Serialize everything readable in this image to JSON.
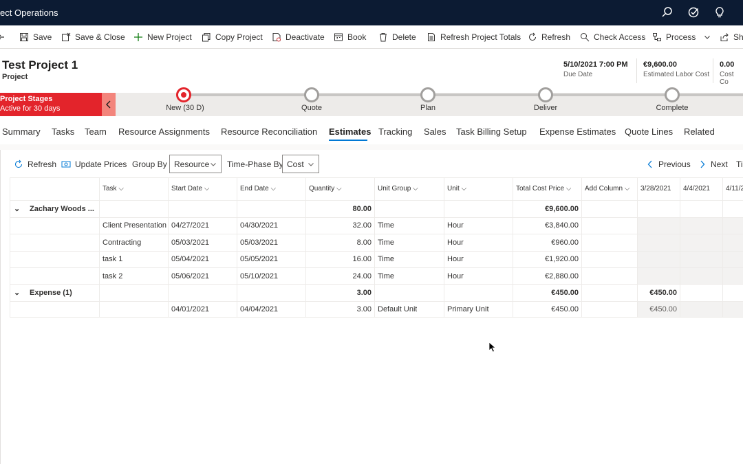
{
  "app": {
    "title": "ect Operations"
  },
  "commands": [
    {
      "label": "Save",
      "icon": "save-icon"
    },
    {
      "label": "Save & Close",
      "icon": "save-close-icon"
    },
    {
      "label": "New Project",
      "icon": "plus-icon"
    },
    {
      "label": "Copy Project",
      "icon": "copy-icon"
    },
    {
      "label": "Deactivate",
      "icon": "deactivate-icon"
    },
    {
      "label": "Book",
      "icon": "book-icon"
    },
    {
      "label": "Delete",
      "icon": "trash-icon"
    },
    {
      "label": "Refresh Project Totals",
      "icon": "document-icon"
    },
    {
      "label": "Refresh",
      "icon": "refresh-icon"
    },
    {
      "label": "Check Access",
      "icon": "search-icon"
    },
    {
      "label": "Process",
      "icon": "process-icon"
    },
    {
      "label": "Sh",
      "icon": "share-icon"
    }
  ],
  "header": {
    "title": "Test Project 1",
    "entity": "Project",
    "fields": [
      {
        "value": "5/10/2021 7:00 PM",
        "label": "Due Date"
      },
      {
        "value": "€9,600.00",
        "label": "Estimated Labor Cost"
      },
      {
        "value": "0.00",
        "label": "Cost Co"
      }
    ]
  },
  "stages": {
    "badge_title": "Project Stages",
    "badge_sub": "Active for 30 days",
    "items": [
      "New  (30 D)",
      "Quote",
      "Plan",
      "Deliver",
      "Complete"
    ]
  },
  "tabs": [
    "Summary",
    "Tasks",
    "Team",
    "Resource Assignments",
    "Resource Reconciliation",
    "Estimates",
    "Tracking",
    "Sales",
    "Task Billing Setup",
    "Expense Estimates",
    "Quote Lines",
    "Related"
  ],
  "grid_toolbar": {
    "refresh": "Refresh",
    "update_prices": "Update Prices",
    "group_by_label": "Group By",
    "group_by_value": "Resource",
    "time_phase_label": "Time-Phase By",
    "time_phase_value": "Cost",
    "previous": "Previous",
    "next": "Next",
    "ti": "Ti"
  },
  "grid": {
    "columns": [
      "Task",
      "Start Date",
      "End Date",
      "Quantity",
      "Unit Group",
      "Unit",
      "Total Cost Price",
      "Add Column",
      "3/28/2021",
      "4/4/2021",
      "4/11/2"
    ],
    "groups": [
      {
        "name": "Zachary Woods ...",
        "quantity": "80.00",
        "total": "€9,600.00",
        "week1": "",
        "rows": [
          {
            "task": "Client Presentation",
            "start": "04/27/2021",
            "end": "04/30/2021",
            "qty": "32.00",
            "ugroup": "Time",
            "unit": "Hour",
            "total": "€3,840.00",
            "week1": ""
          },
          {
            "task": "Contracting",
            "start": "05/03/2021",
            "end": "05/03/2021",
            "qty": "8.00",
            "ugroup": "Time",
            "unit": "Hour",
            "total": "€960.00",
            "week1": ""
          },
          {
            "task": "task 1",
            "start": "05/04/2021",
            "end": "05/05/2021",
            "qty": "16.00",
            "ugroup": "Time",
            "unit": "Hour",
            "total": "€1,920.00",
            "week1": ""
          },
          {
            "task": "task 2",
            "start": "05/06/2021",
            "end": "05/10/2021",
            "qty": "24.00",
            "ugroup": "Time",
            "unit": "Hour",
            "total": "€2,880.00",
            "week1": ""
          }
        ]
      },
      {
        "name": "Expense (1)",
        "quantity": "3.00",
        "total": "€450.00",
        "week1": "€450.00",
        "rows": [
          {
            "task": "",
            "start": "04/01/2021",
            "end": "04/04/2021",
            "qty": "3.00",
            "ugroup": "Default Unit",
            "unit": "Primary Unit",
            "total": "€450.00",
            "week1": "€450.00"
          }
        ]
      }
    ]
  }
}
